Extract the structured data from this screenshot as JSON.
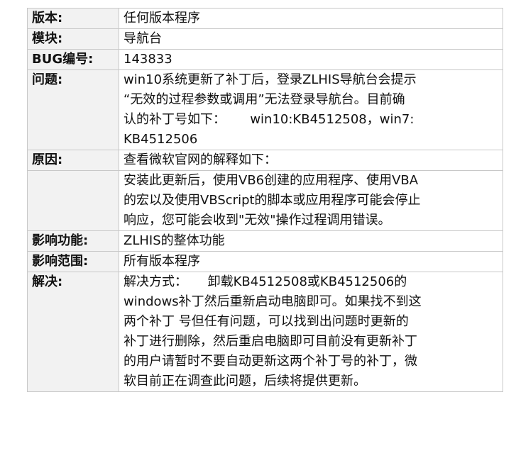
{
  "rows": [
    {
      "label": "版本:",
      "lines": [
        "任何版本程序"
      ]
    },
    {
      "label": "模块:",
      "lines": [
        "导航台"
      ]
    },
    {
      "label": "BUG编号:",
      "lines": [
        "143833"
      ]
    },
    {
      "label": "问题:",
      "lines": [
        "win10系统更新了补丁后，登录ZLHIS导航台会提示",
        "“无效的过程参数或调用”无法登录导航台。目前确",
        "认的补丁号如下：      win10:KB4512508，win7:",
        "KB4512506"
      ]
    },
    {
      "label": "原因:",
      "lines": [
        "查看微软官网的解释如下："
      ]
    },
    {
      "label": "",
      "lines": [
        "安装此更新后，使用VB6创建的应用程序、使用VBA",
        "的宏以及使用VBScript的脚本或应用程序可能会停止",
        "响应，您可能会收到\"无效\"操作过程调用错误。"
      ]
    },
    {
      "label": "影响功能:",
      "lines": [
        "ZLHIS的整体功能"
      ]
    },
    {
      "label": "影响范围:",
      "lines": [
        "所有版本程序"
      ]
    },
    {
      "label": "解决:",
      "lines": [
        "解决方式：     卸载KB4512508或KB4512506的",
        "windows补丁然后重新启动电脑即可。如果找不到这",
        "两个补丁 号但任有问题，可以找到出问题时更新的",
        "补丁进行删除，然后重启电脑即可目前没有更新补丁",
        "的用户请暂时不要自动更新这两个补丁号的补丁，微",
        "软目前正在调查此问题，后续将提供更新。"
      ]
    }
  ]
}
